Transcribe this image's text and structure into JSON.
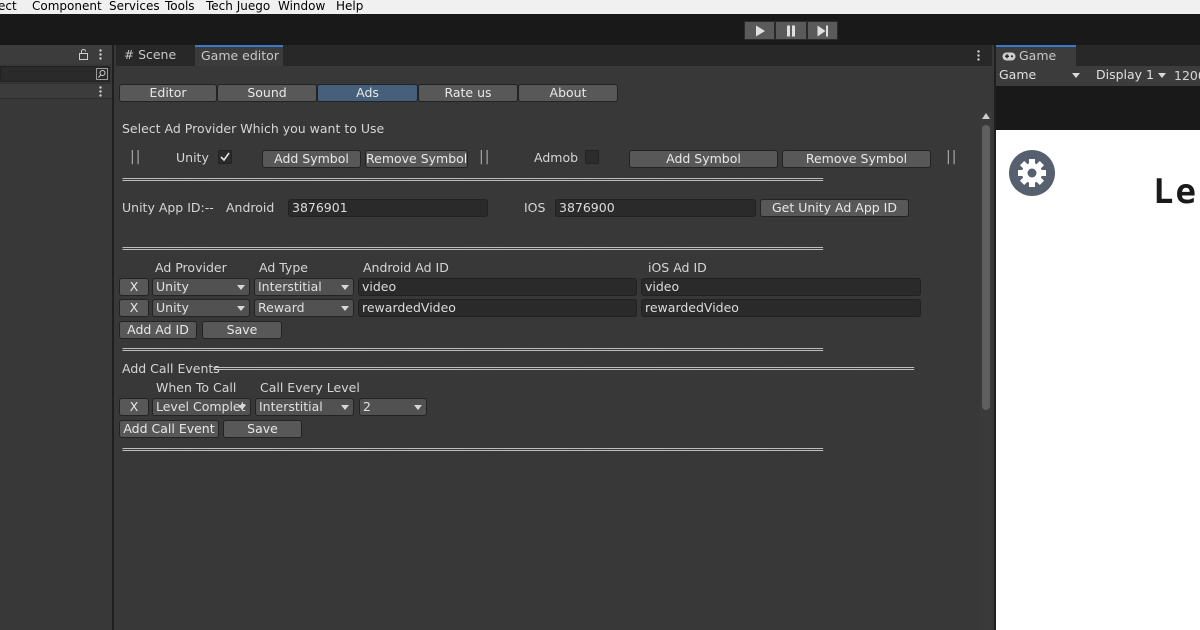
{
  "menubar": {
    "items": [
      "ect",
      "Component",
      "Services",
      "Tools",
      "Tech Juego",
      "Window",
      "Help"
    ]
  },
  "toolbar": {
    "play_icon": "play-icon",
    "pause_icon": "pause-icon",
    "step_icon": "step-icon"
  },
  "center": {
    "tabs": {
      "scene": "Scene",
      "game_editor": "Game editor"
    },
    "nav": {
      "editor": "Editor",
      "sound": "Sound",
      "ads": "Ads",
      "rate_us": "Rate us",
      "about": "About"
    },
    "provider_heading": "Select Ad Provider Which you want to Use",
    "unity_label": "Unity",
    "unity_checked": true,
    "admob_label": "Admob",
    "admob_checked": false,
    "add_symbol": "Add  Symbol",
    "remove_symbol": "Remove Symbol",
    "bars": "||",
    "separator": "================================================================================================================================",
    "app_id": {
      "label": "Unity App ID:--",
      "android_label": "Android",
      "android_value": "3876901",
      "ios_label": "IOS",
      "ios_value": "3876900",
      "get_button": "Get Unity Ad App ID"
    },
    "ads_table": {
      "headers": {
        "provider": "Ad Provider",
        "type": "Ad Type",
        "android": "Android Ad ID",
        "ios": "iOS Ad ID"
      },
      "rows": [
        {
          "remove": "X",
          "provider": "Unity",
          "type": "Interstitial",
          "android": "video",
          "ios": "video"
        },
        {
          "remove": "X",
          "provider": "Unity",
          "type": "Reward",
          "android": "rewardedVideo",
          "ios": "rewardedVideo"
        }
      ],
      "add_button": "Add Ad ID",
      "save_button": "Save"
    },
    "call_events": {
      "heading": "Add Call Events",
      "headers": {
        "when": "When To Call",
        "call_every": "Call Every Level"
      },
      "rows": [
        {
          "remove": "X",
          "when": "Level Complet",
          "type": "Interstitial",
          "level": "2"
        }
      ],
      "add_button": "Add Call Event",
      "save_button": "Save"
    }
  },
  "right": {
    "tab": "Game",
    "view_select": "Game",
    "display_select": "Display 1",
    "resolution": "1200",
    "game_text": "Le"
  },
  "colors": {
    "accent": "#3a78c8",
    "selected_tab": "#46607c",
    "panel_bg": "#383838"
  }
}
